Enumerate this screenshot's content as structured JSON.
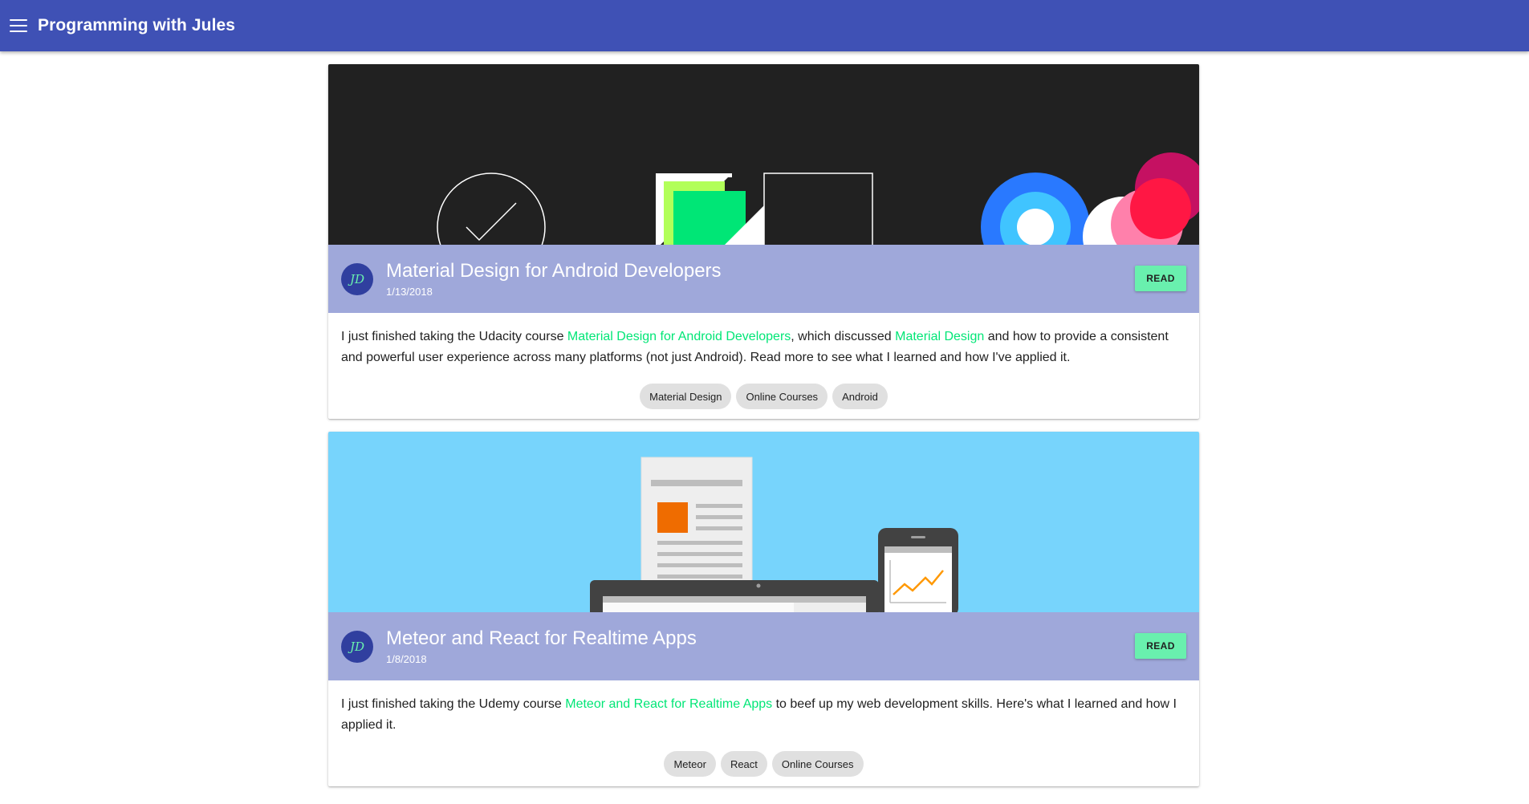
{
  "app": {
    "title": "Programming with Jules",
    "brand_color": "#3f51b5",
    "accent_color": "#69f0ae"
  },
  "posts": [
    {
      "avatar_initials": "JD",
      "title": "Material Design for Android Developers",
      "date": "1/13/2018",
      "read_label": "READ",
      "body": {
        "t1": "I just finished taking the Udacity course ",
        "link1": "Material Design for Android Developers",
        "t2": ", which discussed ",
        "link2": "Material Design",
        "t3": " and how to provide a consistent and powerful user experience across many platforms (not just Android). Read more to see what I learned and how I've applied it."
      },
      "tags": [
        "Material Design",
        "Online Courses",
        "Android"
      ]
    },
    {
      "avatar_initials": "JD",
      "title": "Meteor and React for Realtime Apps",
      "date": "1/8/2018",
      "read_label": "READ",
      "body": {
        "t1": "I just finished taking the Udemy course ",
        "link1": "Meteor and React for Realtime Apps",
        "t2": " to beef up my web development skills. Here's what I learned and how I applied it."
      },
      "tags": [
        "Meteor",
        "React",
        "Online Courses"
      ]
    }
  ]
}
